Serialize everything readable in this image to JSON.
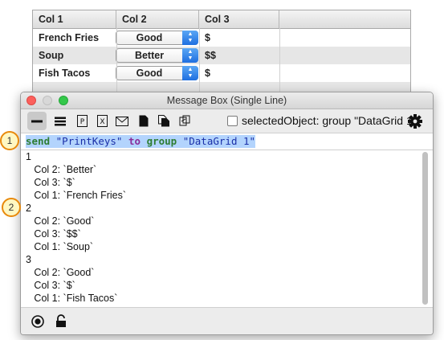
{
  "grid": {
    "columns": [
      "Col 1",
      "Col 2",
      "Col 3"
    ],
    "rows": [
      {
        "col1": "French Fries",
        "col2": "Good",
        "col3": "$"
      },
      {
        "col1": "Soup",
        "col2": "Better",
        "col3": "$$"
      },
      {
        "col1": "Fish Tacos",
        "col2": "Good",
        "col3": "$"
      }
    ]
  },
  "window": {
    "title": "Message Box (Single Line)"
  },
  "toolbar": {
    "selected_object_label": "selectedObject: group \"DataGrid 1\""
  },
  "command": {
    "kw_send": "send",
    "str_key": "\"PrintKeys\"",
    "kw_to": "to",
    "kw_group": "group",
    "str_name": "\"DataGrid 1\""
  },
  "output": {
    "lines": [
      "1",
      "   Col 2: `Better`",
      "   Col 3: `$`",
      "   Col 1: `French Fries`",
      "2",
      "   Col 2: `Good`",
      "   Col 3: `$$`",
      "   Col 1: `Soup`",
      "3",
      "   Col 2: `Good`",
      "   Col 3: `$`",
      "   Col 1: `Fish Tacos`"
    ]
  },
  "callouts": [
    "1",
    "2"
  ],
  "colors": {
    "selection": "#b3d4fd",
    "keyword": "#2e7d32",
    "string": "#1a2fa8",
    "callout_border": "#e8890b",
    "callout_fill": "#fff7c2"
  }
}
